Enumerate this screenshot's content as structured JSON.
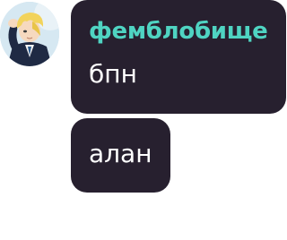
{
  "messages": [
    {
      "sender": "фемблобище",
      "text": "бпн",
      "avatar_icon": "user-avatar-anime"
    },
    {
      "text": "алан"
    }
  ],
  "colors": {
    "bubble_bg": "#27202f",
    "sender_name": "#4fd4c2",
    "message_text": "#ffffff",
    "page_bg": "#ffffff"
  }
}
